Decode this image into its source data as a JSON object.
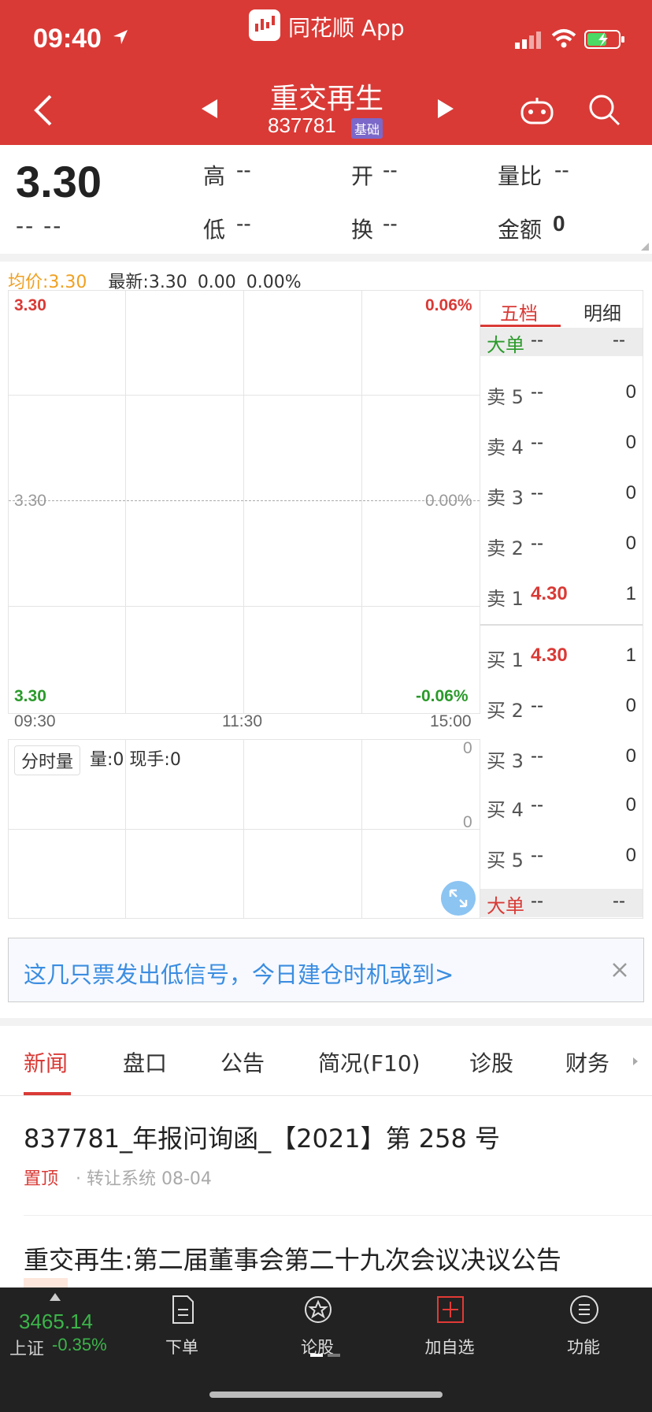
{
  "status_bar": {
    "time": "09:40"
  },
  "header": {
    "app_title": "同花顺 App",
    "stock_name": "重交再生",
    "stock_code": "837781",
    "badge": "基础"
  },
  "quote": {
    "price": "3.30",
    "change": "-- --",
    "fields": [
      {
        "label": "高",
        "value": "--"
      },
      {
        "label": "开",
        "value": "--"
      },
      {
        "label": "量比",
        "value": "--"
      },
      {
        "label": "低",
        "value": "--"
      },
      {
        "label": "换",
        "value": "--"
      },
      {
        "label": "金额",
        "value": "0"
      }
    ]
  },
  "chart": {
    "avg_label": "均价:3.30",
    "latest_label": "最新:3.30",
    "latest_change": "0.00",
    "latest_pct": "0.00%",
    "y_top_price": "3.30",
    "y_top_pct": "0.06%",
    "y_mid_price": "3.30",
    "y_mid_pct": "0.00%",
    "y_bot_price": "3.30",
    "y_bot_pct": "-0.06%",
    "times": [
      "09:30",
      "11:30",
      "15:00"
    ]
  },
  "volume": {
    "tag": "分时量",
    "info": "量:0 现手:0",
    "top": "0",
    "mid": "0"
  },
  "order_book": {
    "tab_active": "五档",
    "tab_other": "明细",
    "big_order_label": "大单",
    "big_order_a": "--",
    "big_order_b": "--",
    "sells": [
      {
        "label": "卖 5",
        "price": "--",
        "qty": "0"
      },
      {
        "label": "卖 4",
        "price": "--",
        "qty": "0"
      },
      {
        "label": "卖 3",
        "price": "--",
        "qty": "0"
      },
      {
        "label": "卖 2",
        "price": "--",
        "qty": "0"
      },
      {
        "label": "卖 1",
        "price": "4.30",
        "qty": "1"
      }
    ],
    "buys": [
      {
        "label": "买 1",
        "price": "4.30",
        "qty": "1"
      },
      {
        "label": "买 2",
        "price": "--",
        "qty": "0"
      },
      {
        "label": "买 3",
        "price": "--",
        "qty": "0"
      },
      {
        "label": "买 4",
        "price": "--",
        "qty": "0"
      },
      {
        "label": "买 5",
        "price": "--",
        "qty": "0"
      }
    ]
  },
  "banner": {
    "text": "这几只票发出低信号，今日建仓时机或到>"
  },
  "tabs": [
    "新闻",
    "盘口",
    "公告",
    "简况(F10)",
    "诊股",
    "财务"
  ],
  "news": [
    {
      "title": "837781_年报问询函_【2021】第 258 号",
      "tag": "置顶",
      "meta": "· 转让系统 08-04"
    },
    {
      "title": "重交再生:第二届董事会第二十九次会议决议公告"
    }
  ],
  "bottom_bar": {
    "index_value": "3465.14",
    "index_name": "上证",
    "index_change": "-0.35%",
    "items": [
      "下单",
      "论股",
      "加自选",
      "功能"
    ]
  },
  "colors": {
    "header_red": "#d93a36",
    "rise_red": "#d93a36",
    "fall_green": "#2a9a2a",
    "link_blue": "#3b8de0"
  }
}
